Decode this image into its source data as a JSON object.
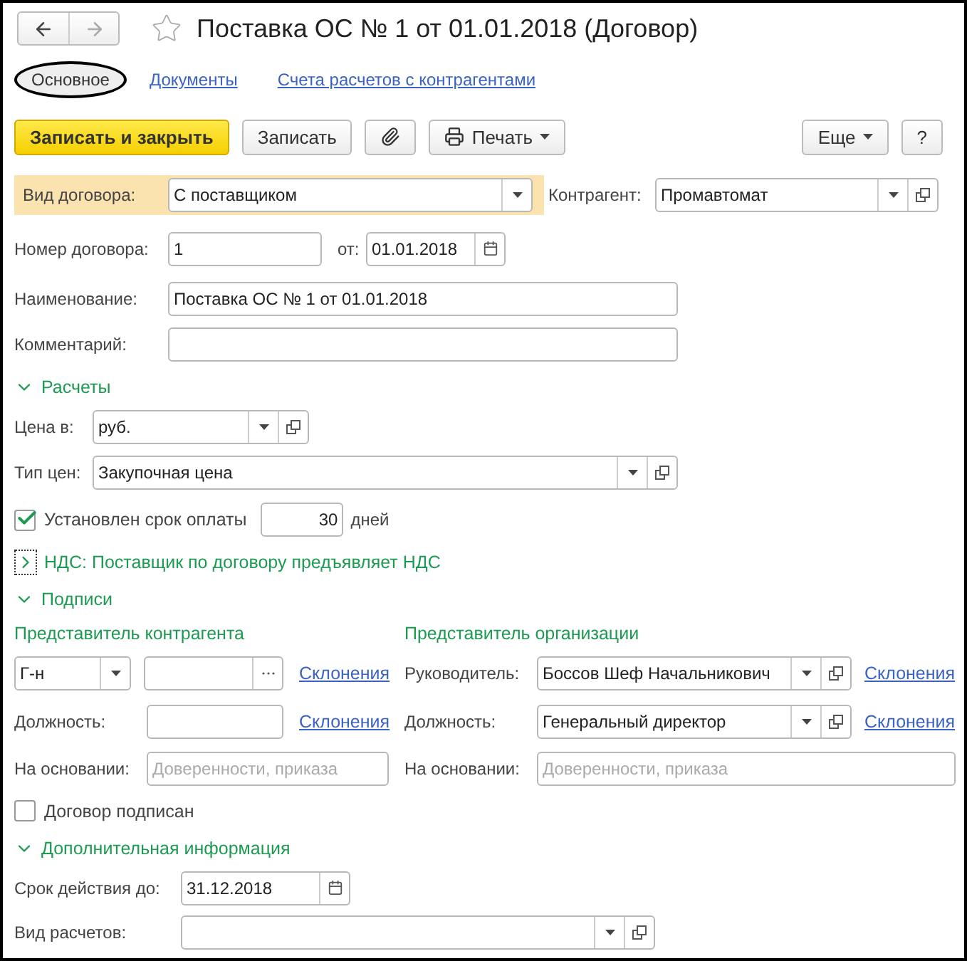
{
  "window": {
    "title": "Поставка ОС № 1 от 01.01.2018 (Договор)",
    "favorite": false
  },
  "nav": [
    {
      "kind": "back",
      "disabled": false
    },
    {
      "kind": "forward",
      "disabled": true
    }
  ],
  "tabs": [
    {
      "label": "Основное",
      "selected": true
    },
    {
      "label": "Документы",
      "selected": false
    },
    {
      "label": "Счета расчетов с контрагентами",
      "selected": false
    }
  ],
  "toolbar": {
    "left": [
      {
        "kind": "primary",
        "label": "Записать и закрыть"
      },
      {
        "kind": "plain",
        "label": "Записать"
      },
      {
        "kind": "attach"
      },
      {
        "kind": "print",
        "label": "Печать"
      }
    ],
    "right": [
      {
        "kind": "more",
        "label": "Еще"
      },
      {
        "kind": "plain",
        "label": "?"
      }
    ]
  },
  "main": {
    "contract_type": {
      "label": "Вид договора:",
      "value": "С поставщиком",
      "highlighted": true
    },
    "counterparty": {
      "label": "Контрагент:",
      "value": "Промавтомат"
    },
    "number": {
      "label": "Номер договора:",
      "value": "1"
    },
    "date": {
      "label": "от:",
      "value": "01.01.2018"
    },
    "name": {
      "label": "Наименование:",
      "value": "Поставка ОС № 1 от 01.01.2018"
    },
    "comment": {
      "label": "Комментарий:"
    }
  },
  "payments": {
    "title": "Расчеты",
    "expanded": true,
    "currency": {
      "label": "Цена в:",
      "value": "руб."
    },
    "price_type": {
      "label": "Тип цен:",
      "value": "Закупочная цена"
    },
    "payment_term": {
      "label": "Установлен срок оплаты",
      "checked": true,
      "value": "30",
      "unit": "дней"
    }
  },
  "vat": {
    "title": "НДС: Поставщик по договору предъявляет НДС",
    "expanded": false
  },
  "signatures": {
    "title": "Подписи",
    "expanded": true,
    "counterparty_rep": {
      "title": "Представитель контрагента",
      "salutation": "Г-н",
      "declensions": "Склонения",
      "position_label": "Должность:",
      "position_declensions": "Склонения",
      "basis_label": "На основании:",
      "basis_placeholder": "Доверенности, приказа"
    },
    "organization_rep": {
      "title": "Представитель организации",
      "head_label": "Руководитель:",
      "head": "Боссов Шеф Начальникович",
      "declensions": "Склонения",
      "position_label": "Должность:",
      "position": "Генеральный директор",
      "position_declensions": "Склонения",
      "basis_label": "На основании:",
      "basis_placeholder": "Доверенности, приказа"
    },
    "signed": {
      "label": "Договор подписан",
      "checked": false
    }
  },
  "additional": {
    "title": "Дополнительная информация",
    "expanded": true,
    "valid_until": {
      "label": "Срок действия до:",
      "value": "31.12.2018"
    },
    "settlement_type": {
      "label": "Вид расчетов:"
    }
  }
}
